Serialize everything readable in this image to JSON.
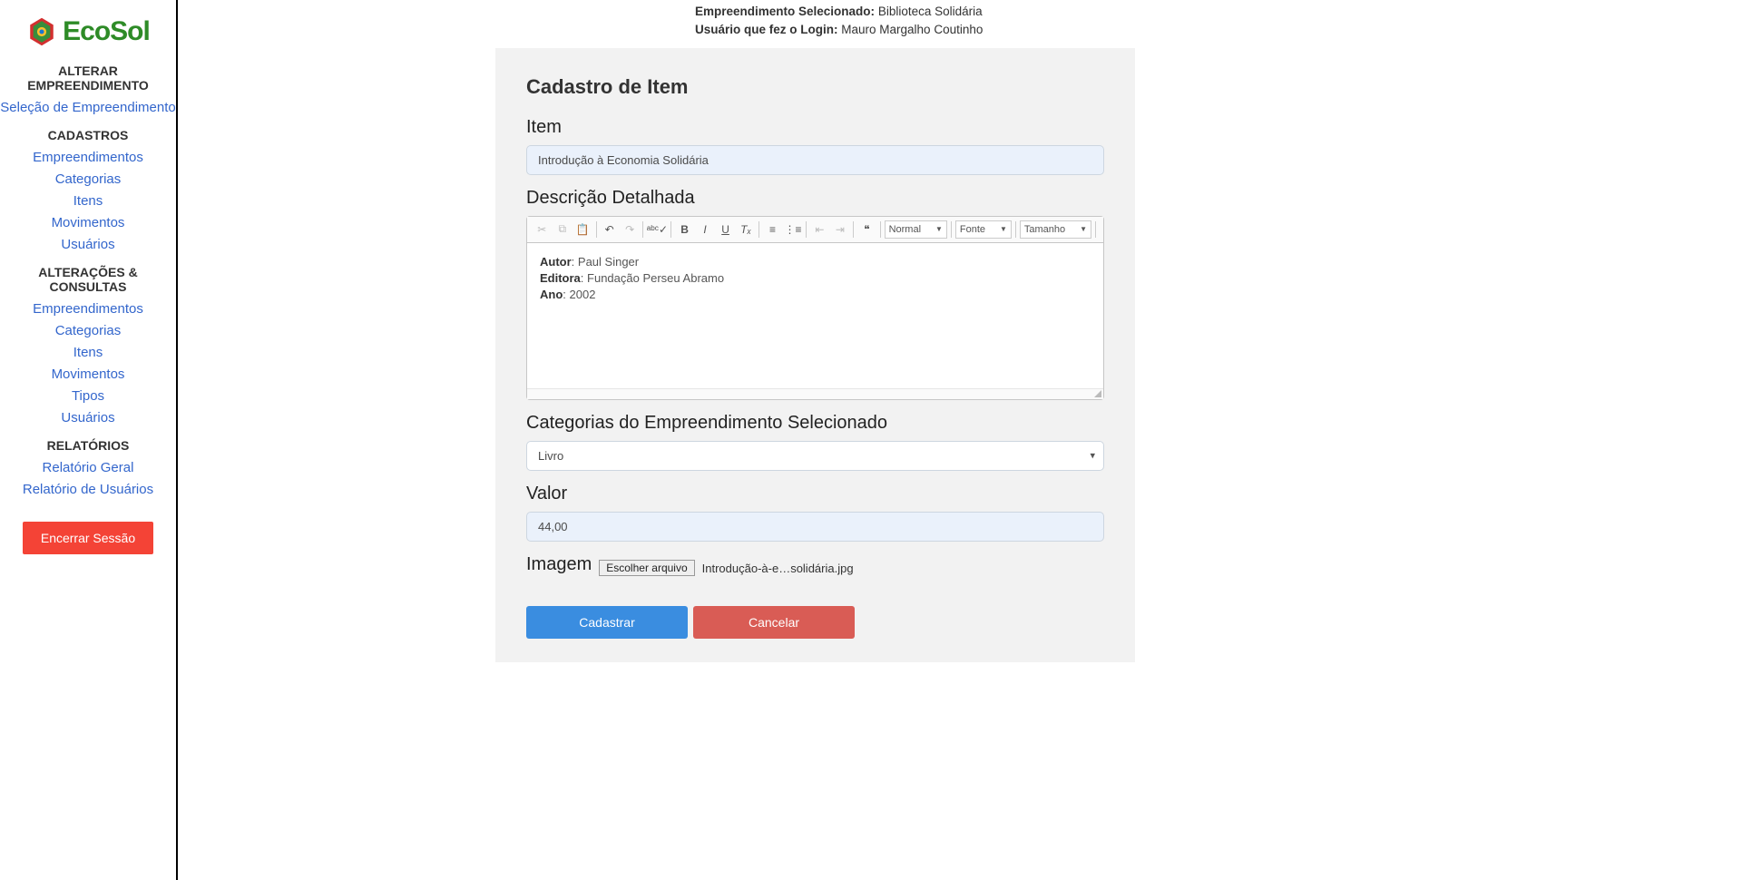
{
  "logo": {
    "text": "EcoSol"
  },
  "top_info": {
    "selected_label": "Empreendimento Selecionado:",
    "selected_value": "Biblioteca Solidária",
    "user_label": "Usuário que fez o Login:",
    "user_value": "Mauro Margalho Coutinho"
  },
  "nav": {
    "sect_alterar": "ALTERAR EMPREENDIMENTO",
    "link_selecao": "Seleção de Empreendimento",
    "sect_cadastros": "CADASTROS",
    "link_empre1": "Empreendimentos",
    "link_categ1": "Categorias",
    "link_itens1": "Itens",
    "link_mov1": "Movimentos",
    "link_user1": "Usuários",
    "sect_alt_cons": "ALTERAÇÕES & CONSULTAS",
    "link_empre2": "Empreendimentos",
    "link_categ2": "Categorias",
    "link_itens2": "Itens",
    "link_mov2": "Movimentos",
    "link_tipos": "Tipos",
    "link_user2": "Usuários",
    "sect_relat": "RELATÓRIOS",
    "link_rel_geral": "Relatório Geral",
    "link_rel_user": "Relatório de Usuários",
    "logout": "Encerrar Sessão"
  },
  "form": {
    "title": "Cadastro de Item",
    "item_label": "Item",
    "item_value": "Introdução à Economia Solidária",
    "desc_label": "Descrição Detalhada",
    "desc_author_label": "Autor",
    "desc_author_value": ": Paul Singer",
    "desc_editor_label": "Editora",
    "desc_editor_value": ": Fundação Perseu Abramo",
    "desc_year_label": "Ano",
    "desc_year_value": ": 2002",
    "cat_label": "Categorias do Empreendimento Selecionado",
    "cat_value": "Livro",
    "valor_label": "Valor",
    "valor_value": "44,00",
    "img_label": "Imagem",
    "file_button": "Escolher arquivo",
    "file_name": "Introdução-à-e…solidária.jpg",
    "submit": "Cadastrar",
    "cancel": "Cancelar"
  },
  "toolbar": {
    "cut": "✂",
    "copy": "⧉",
    "paste": "📋",
    "undo": "↶",
    "redo": "↷",
    "spell": "ᵃᵇᶜ✓",
    "bold": "B",
    "italic": "I",
    "underline": "U",
    "remove_fmt": "Tₓ",
    "ol": "≡",
    "ul": "⋮≡",
    "outdent": "⇤",
    "indent": "⇥",
    "quote": "❝",
    "format_select": "Normal",
    "font_select": "Fonte",
    "size_select": "Tamanho"
  }
}
